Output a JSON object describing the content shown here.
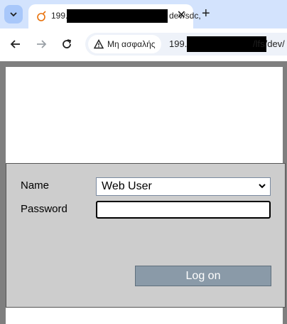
{
  "browser": {
    "tab": {
      "title_start": "199.",
      "title_tail": "dev/sdc,",
      "favicon": "loading-spinner-icon"
    },
    "toolbar": {
      "security_label": "Μη ασφαλής",
      "url_start": "199.",
      "url_tail": "/lfs/dev/"
    },
    "icons": {
      "tab_menu": "chevron-down-icon",
      "close": "close-icon",
      "new_tab": "plus-icon",
      "back": "back-arrow-icon",
      "forward": "forward-arrow-icon",
      "reload": "reload-icon",
      "security": "warning-icon"
    },
    "colors": {
      "tabstrip": "#d3e3fd",
      "security_chip": "#ffffff",
      "omnibox": "#eef2f9"
    }
  },
  "login": {
    "name_label": "Name",
    "name_value": "Web User",
    "password_label": "Password",
    "password_value": "",
    "logon_label": "Log on",
    "colors": {
      "panel": "#cdcdcd",
      "button": "#8a9aa8"
    }
  }
}
